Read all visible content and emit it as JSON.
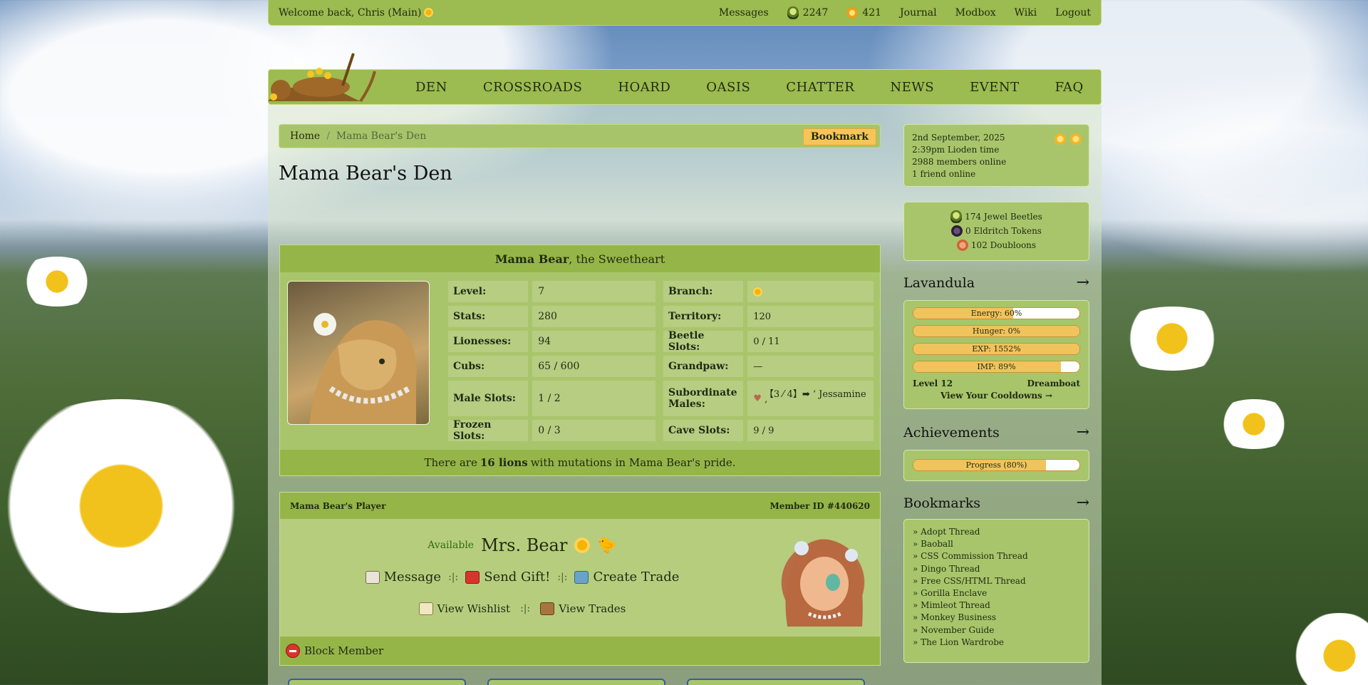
{
  "topbar": {
    "welcome": "Welcome back, Chris (Main)",
    "links": [
      {
        "label": "Messages"
      },
      {
        "label": "2247",
        "icon": "beetle-icon"
      },
      {
        "label": "421",
        "icon": "coin-icon"
      },
      {
        "label": "Journal"
      },
      {
        "label": "Modbox"
      },
      {
        "label": "Wiki"
      },
      {
        "label": "Logout"
      }
    ]
  },
  "nav": [
    "DEN",
    "CROSSROADS",
    "HOARD",
    "OASIS",
    "CHATTER",
    "NEWS",
    "EVENT",
    "FAQ"
  ],
  "breadcrumb": {
    "home": "Home",
    "sep": "/",
    "current": "Mama Bear's Den",
    "bookmark": "Bookmark"
  },
  "page_title": "Mama Bear's Den",
  "den": {
    "name": "Mama Bear",
    "title_suffix": ", the Sweetheart",
    "left_stats": [
      {
        "label": "Level:",
        "value": "7"
      },
      {
        "label": "Stats:",
        "value": "280"
      },
      {
        "label": "Lionesses:",
        "value": "94"
      },
      {
        "label": "Cubs:",
        "value": "65 / 600"
      },
      {
        "label": "Male Slots:",
        "value": "1 / 2"
      },
      {
        "label": "Frozen Slots:",
        "value": "0 / 3"
      }
    ],
    "right_stats": [
      {
        "label": "Branch:",
        "value": ""
      },
      {
        "label": "Territory:",
        "value": "120"
      },
      {
        "label": "Beetle Slots:",
        "value": "0 / 11"
      },
      {
        "label": "Grandpaw:",
        "value": "—"
      },
      {
        "label": "Subordinate Males:",
        "value": "【3 ⁄ 4】➡ ‘ Jessamine ’"
      },
      {
        "label": "Cave Slots:",
        "value": "9 / 9"
      }
    ],
    "footer_pre": "There are ",
    "footer_count": "16 lions",
    "footer_post": " with mutations in Mama Bear's pride."
  },
  "player": {
    "heading": "Mama Bear's Player",
    "member_id": "Member ID #440620",
    "status": "Available",
    "name": "Mrs. Bear",
    "message": "Message",
    "gift": "Send Gift!",
    "trade": "Create Trade",
    "wishlist": "View Wishlist",
    "trades": "View Trades",
    "divider": ":|:",
    "block": "Block Member"
  },
  "sidebar": {
    "date": "2nd September, 2025",
    "time": "2:39pm Lioden time",
    "members": "2988 members online",
    "friends": "1 friend online",
    "jewel_beetles": "174 Jewel Beetles",
    "eldritch": "0 Eldritch Tokens",
    "doubloons": "102 Doubloons",
    "lion_name": "Lavandula",
    "bars": [
      {
        "label": "Energy: 60%",
        "fill": 0.6
      },
      {
        "label": "Hunger: 0%",
        "fill": 1.0
      },
      {
        "label": "EXP: 1552%",
        "fill": 1.0
      },
      {
        "label": "IMP: 89%",
        "fill": 0.89
      }
    ],
    "level": "Level 12",
    "dream": "Dreamboat",
    "cooldowns": "View Your Cooldowns →",
    "achievements_title": "Achievements",
    "progress": {
      "label": "Progress (80%)",
      "fill": 0.8
    },
    "bookmarks_title": "Bookmarks",
    "bookmarks": [
      "» Adopt Thread",
      "» Baoball",
      "» CSS Commission Thread",
      "» Dingo Thread",
      "» Free CSS/HTML Thread",
      "» Gorilla Enclave",
      "» Mimleot Thread",
      "» Monkey Business",
      "» November Guide",
      "» The Lion Wardrobe"
    ],
    "arrow": "→"
  }
}
